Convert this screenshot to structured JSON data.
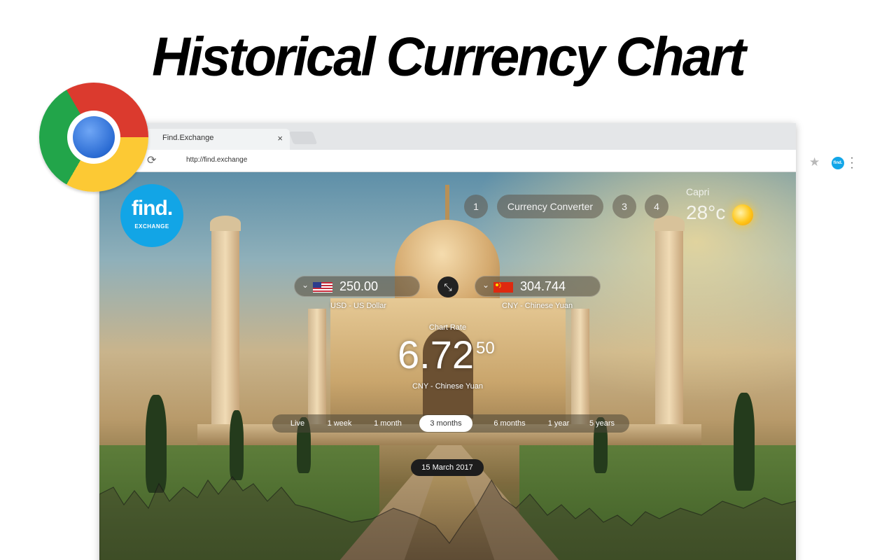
{
  "headline": "Historical Currency Chart",
  "browser": {
    "tab_title": "Find.Exchange",
    "tab_close": "×",
    "url": "http://find.exchange",
    "extension_label": "find."
  },
  "app": {
    "logo": {
      "word": "find.",
      "sub": "EXCHANGE"
    },
    "nav": [
      {
        "label": "1"
      },
      {
        "label": "Currency Converter"
      },
      {
        "label": "3"
      },
      {
        "label": "4"
      }
    ],
    "weather": {
      "city": "Capri",
      "temp": "28°c",
      "icon": "sun-icon"
    },
    "from": {
      "amount": "250.00",
      "name": "USD - US Dollar",
      "flag": "us-flag-icon"
    },
    "to": {
      "amount": "304.744",
      "name": "CNY - Chinese Yuan",
      "flag": "cn-flag-icon"
    },
    "rate": {
      "label": "Chart Rate",
      "main": "6.72",
      "decimals": "50",
      "currency": "CNY - Chinese Yuan"
    },
    "ranges": [
      {
        "label": "Live",
        "active": false
      },
      {
        "label": "1 week",
        "active": false
      },
      {
        "label": "1 month",
        "active": false
      },
      {
        "label": "3 months",
        "active": true
      },
      {
        "label": "6 months",
        "active": false
      },
      {
        "label": "1 year",
        "active": false
      },
      {
        "label": "5 years",
        "active": false
      }
    ],
    "date": "15 March 2017"
  },
  "colors": {
    "brand": "#12a5e6",
    "active_range_bg": "#ffffff",
    "date_pill_bg": "#1d1d1d"
  }
}
